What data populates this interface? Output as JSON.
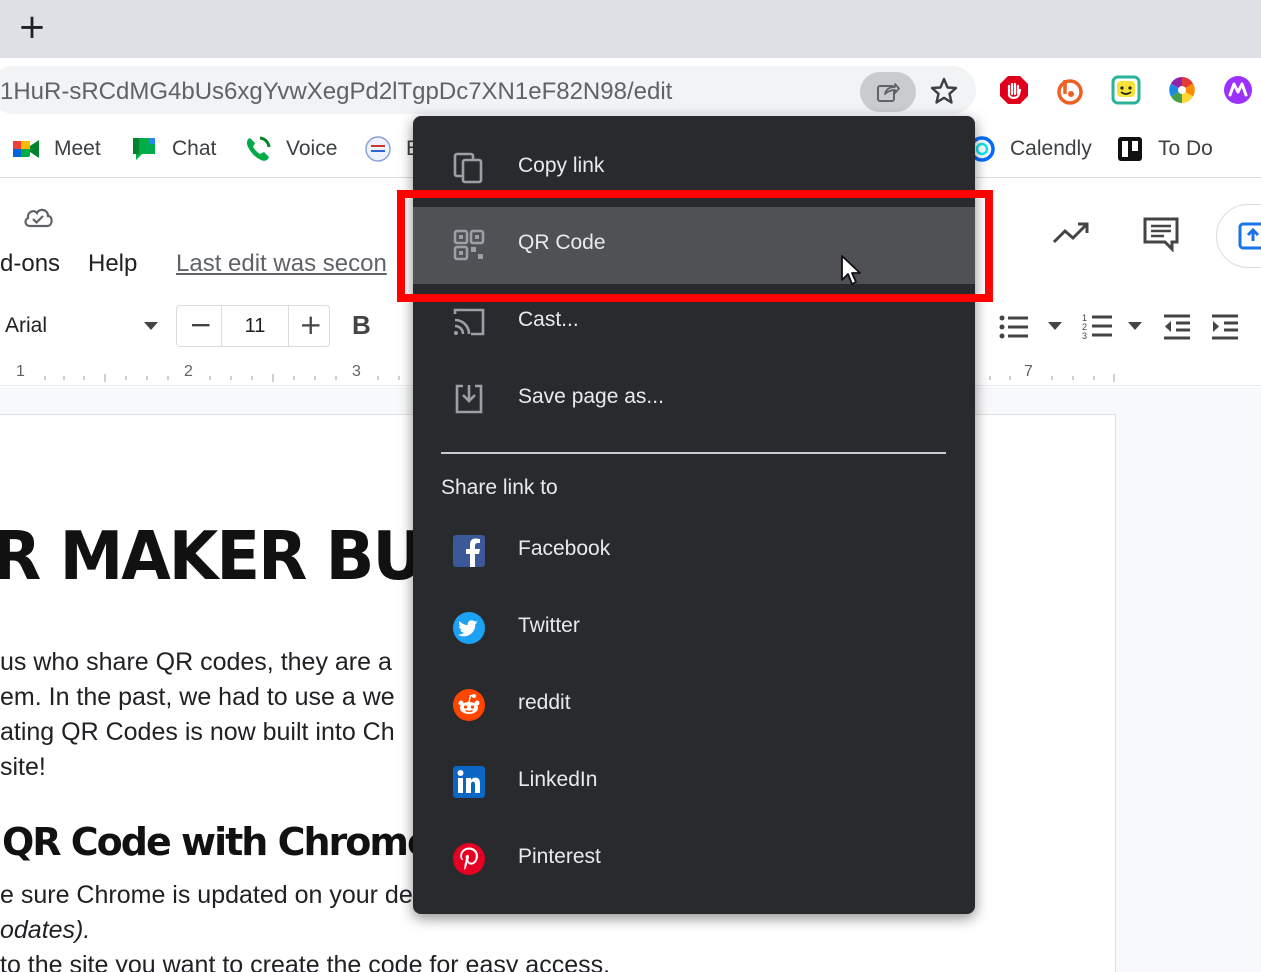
{
  "browser": {
    "url_fragment": "1HuR-sRCdMG4bUs6xgYvwXegPd2lTgpDc7XN1eF82N98/edit",
    "new_tab_symbol": "+"
  },
  "bookmarks": [
    {
      "label": "Meet",
      "icon": "google-meet-icon"
    },
    {
      "label": "Chat",
      "icon": "google-chat-icon"
    },
    {
      "label": "Voice",
      "icon": "google-voice-icon"
    },
    {
      "label": "E",
      "icon": "bookmark-favicon"
    },
    {
      "label": "Calendly",
      "icon": "calendly-icon"
    },
    {
      "label": "To Do",
      "icon": "trello-icon"
    }
  ],
  "docs": {
    "menu_addons": "d-ons",
    "menu_help": "Help",
    "last_edit": "Last edit was secon",
    "font": "Arial",
    "font_size": "11",
    "size_minus": "−",
    "size_plus": "+",
    "bold": "B",
    "ruler_numbers": [
      "1",
      "2",
      "3",
      "7"
    ]
  },
  "document": {
    "title": "R MAKER BUILT",
    "paragraph_lines": [
      " us who share QR codes, they are a",
      "em. In the past, we had to use a we",
      "ating QR Codes is now built into Ch",
      "site!"
    ],
    "heading": "QR Code with Chrome:",
    "list_lines": [
      "e sure Chrome is updated on your de",
      "odates).",
      " to the site you want to create the code for easy access."
    ]
  },
  "share_menu": {
    "items": [
      {
        "label": "Copy link",
        "icon": "copy-icon"
      },
      {
        "label": "QR Code",
        "icon": "qr-code-icon"
      },
      {
        "label": "Cast...",
        "icon": "cast-icon"
      },
      {
        "label": "Save page as...",
        "icon": "save-page-icon"
      }
    ],
    "share_heading": "Share link to",
    "share_targets": [
      {
        "label": "Facebook",
        "icon": "facebook-icon"
      },
      {
        "label": "Twitter",
        "icon": "twitter-icon"
      },
      {
        "label": "reddit",
        "icon": "reddit-icon"
      },
      {
        "label": "LinkedIn",
        "icon": "linkedin-icon"
      },
      {
        "label": "Pinterest",
        "icon": "pinterest-icon"
      }
    ],
    "highlighted": "QR Code"
  },
  "colors": {
    "menu_bg": "#292a2d",
    "menu_highlight": "#505155",
    "annotation_red": "#ff0000"
  }
}
